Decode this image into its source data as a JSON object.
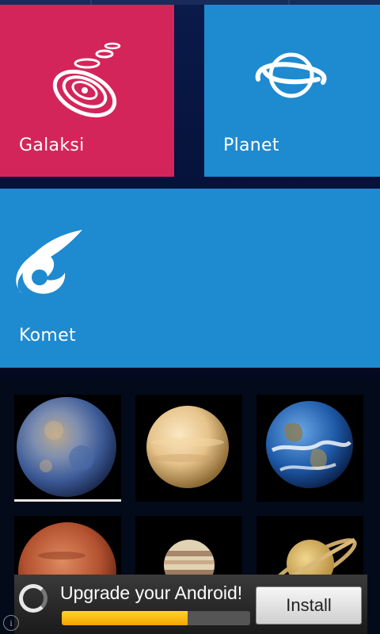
{
  "tiles": {
    "galaksi": {
      "label": "Galaksi",
      "icon": "galaxy-icon",
      "color": "#d4255a"
    },
    "planet": {
      "label": "Planet",
      "icon": "planet-orbit-icon",
      "color": "#1e8ad0"
    },
    "komet": {
      "label": "Komet",
      "icon": "comet-icon",
      "color": "#1e8ad0"
    }
  },
  "planets": [
    {
      "name": "mercury-thumb",
      "selected": true
    },
    {
      "name": "venus-thumb"
    },
    {
      "name": "earth-thumb"
    },
    {
      "name": "mars-thumb"
    },
    {
      "name": "jupiter-thumb"
    },
    {
      "name": "saturn-thumb"
    }
  ],
  "ad": {
    "title": "Upgrade your Android!",
    "install_label": "Install",
    "progress": 0.67
  }
}
